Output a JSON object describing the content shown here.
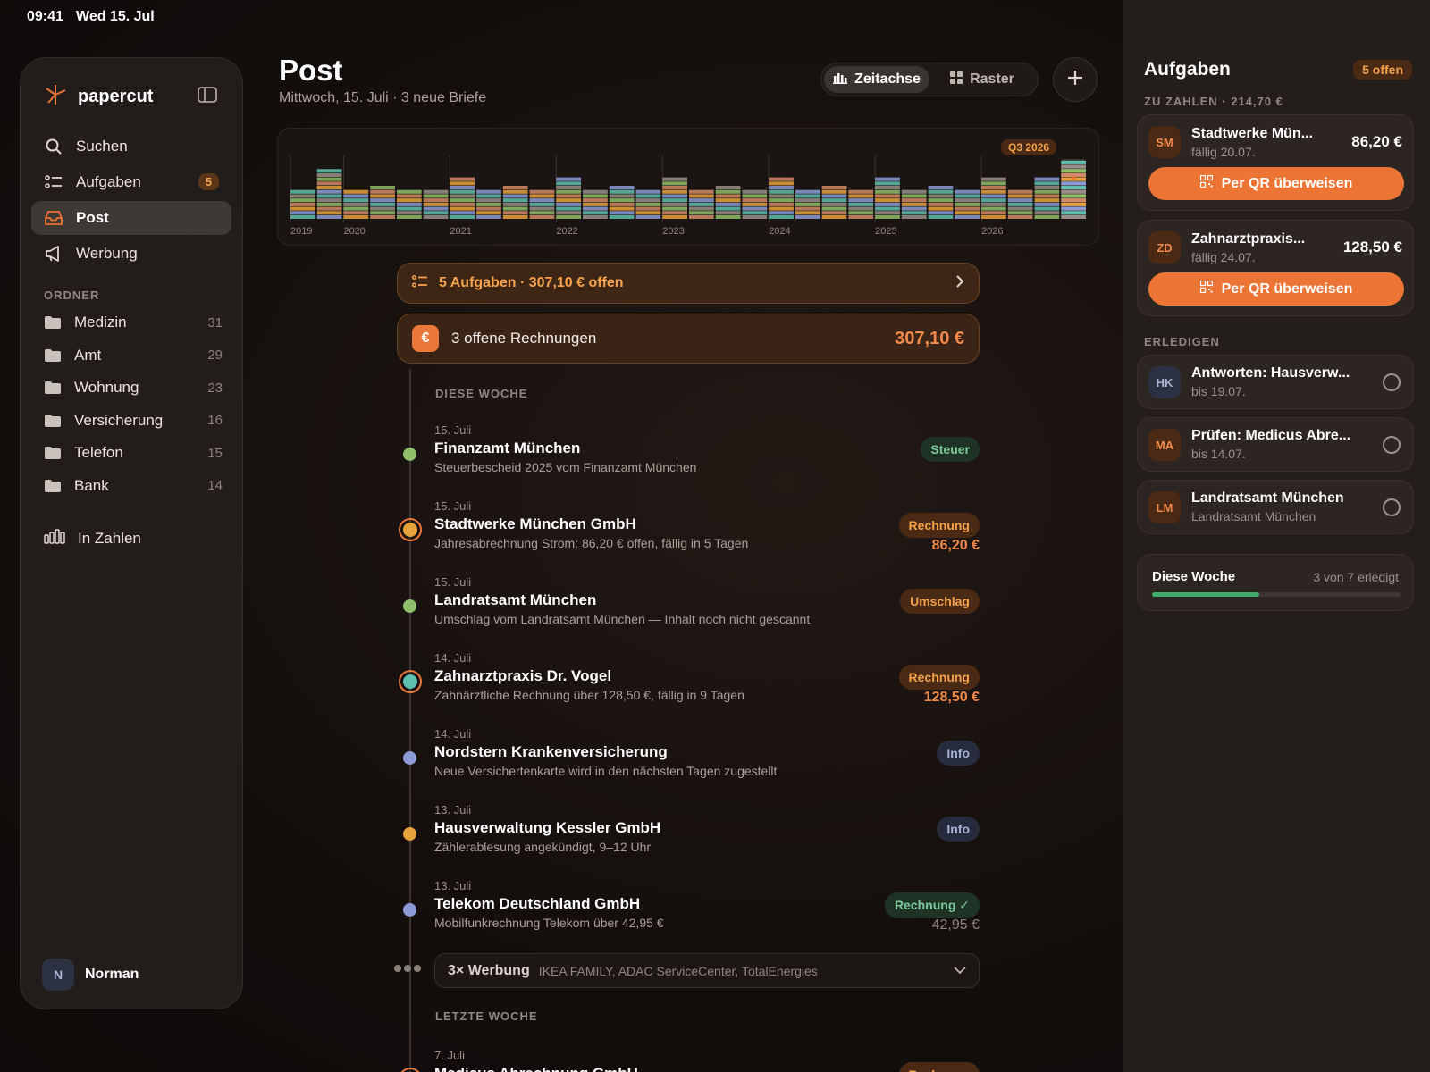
{
  "status": {
    "time": "09:41",
    "date": "Wed 15. Jul"
  },
  "sidebar": {
    "brand": "papercut",
    "nav": [
      {
        "label": "Suchen",
        "icon": "search-icon"
      },
      {
        "label": "Aufgaben",
        "icon": "task-list-icon",
        "badge": "5"
      },
      {
        "label": "Post",
        "icon": "inbox-icon",
        "active": true
      },
      {
        "label": "Werbung",
        "icon": "megaphone-icon"
      }
    ],
    "folders_label": "ORDNER",
    "folders": [
      {
        "label": "Medizin",
        "count": "31"
      },
      {
        "label": "Amt",
        "count": "29"
      },
      {
        "label": "Wohnung",
        "count": "23"
      },
      {
        "label": "Versicherung",
        "count": "16"
      },
      {
        "label": "Telefon",
        "count": "15"
      },
      {
        "label": "Bank",
        "count": "14"
      }
    ],
    "stats_label": "In Zahlen",
    "user": {
      "initial": "N",
      "name": "Norman"
    }
  },
  "main": {
    "title": "Post",
    "subtitle": "Mittwoch, 15. Juli · 3 neue Briefe",
    "view_toggle": {
      "timeline": "Zeitachse",
      "grid": "Raster",
      "active": "timeline"
    },
    "tasks_banner": "5 Aufgaben · 307,10 € offen",
    "invoice_banner": {
      "symbol": "€",
      "text": "3 offene Rechnungen",
      "amount": "307,10 €"
    },
    "group_this_week": "DIESE WOCHE",
    "group_last_week": "LETZTE WOCHE",
    "entries": [
      {
        "date": "15. Juli",
        "title": "Finanzamt München",
        "desc": "Steuerbescheid 2025 vom Finanzamt München",
        "tag": "Steuer",
        "tag_type": "steuer",
        "dot_color": "#8fbf6a",
        "ring": false,
        "amount": ""
      },
      {
        "date": "15. Juli",
        "title": "Stadtwerke München GmbH",
        "desc": "Jahresabrechnung Strom: 86,20 € offen, fällig in 5 Tagen",
        "tag": "Rechnung",
        "tag_type": "rechnung",
        "dot_color": "#e8a23c",
        "ring": true,
        "amount": "86,20 €"
      },
      {
        "date": "15. Juli",
        "title": "Landratsamt München",
        "desc": "Umschlag vom Landratsamt München — Inhalt noch nicht gescannt",
        "tag": "Umschlag",
        "tag_type": "umschlag",
        "dot_color": "#8fbf6a",
        "ring": false,
        "amount": ""
      },
      {
        "date": "14. Juli",
        "title": "Zahnarztpraxis Dr. Vogel",
        "desc": "Zahnärztliche Rechnung über 128,50 €, fällig in 9 Tagen",
        "tag": "Rechnung",
        "tag_type": "rechnung",
        "dot_color": "#5fbfae",
        "ring": true,
        "amount": "128,50 €"
      },
      {
        "date": "14. Juli",
        "title": "Nordstern Krankenversicherung",
        "desc": "Neue Versichertenkarte wird in den nächsten Tagen zugestellt",
        "tag": "Info",
        "tag_type": "info",
        "dot_color": "#8c9bd6",
        "ring": false,
        "amount": ""
      },
      {
        "date": "13. Juli",
        "title": "Hausverwaltung Kessler GmbH",
        "desc": "Zählerablesung angekündigt, 9–12 Uhr",
        "tag": "Info",
        "tag_type": "info",
        "dot_color": "#e8a23c",
        "ring": false,
        "amount": ""
      },
      {
        "date": "13. Juli",
        "title": "Telekom Deutschland GmbH",
        "desc": "Mobilfunkrechnung Telekom über 42,95 €",
        "tag": "Rechnung ✓",
        "tag_type": "paid",
        "dot_color": "#8c9bd6",
        "ring": false,
        "amount": "42,95 €",
        "amount_paid": true
      }
    ],
    "ads": {
      "count": "3× Werbung",
      "list": "IKEA FAMILY, ADAC ServiceCenter, TotalEnergies"
    },
    "last_entry": {
      "date": "7. Juli",
      "title": "Medicus Abrechnung GmbH",
      "tag": "Rechnung",
      "dot_color": "#5fbfae"
    }
  },
  "chart_data": {
    "type": "bar",
    "stacked": true,
    "badge": "Q3 2026",
    "year_labels": [
      "2019",
      "2020",
      "2021",
      "2022",
      "2023",
      "2024",
      "2025",
      "2026"
    ],
    "year_start_index": [
      0,
      2,
      6,
      10,
      14,
      18,
      22,
      26
    ],
    "colors": [
      "#5fbfae",
      "#8c9bd6",
      "#e8a23c",
      "#d38a6a",
      "#8fbf6a",
      "#9a8f88"
    ],
    "quarter_totals": [
      7,
      12,
      7,
      8,
      7,
      7,
      10,
      7,
      8,
      7,
      10,
      7,
      8,
      7,
      10,
      7,
      8,
      7,
      10,
      7,
      8,
      7,
      10,
      7,
      8,
      7,
      10,
      7,
      10,
      14
    ],
    "current_quarter_index": 29
  },
  "rpanel": {
    "title": "Aufgaben",
    "badge": "5 offen",
    "pay_label": "ZU ZAHLEN · 214,70 €",
    "pay_items": [
      {
        "mono": "SM",
        "title": "Stadtwerke Mün...",
        "due": "fällig 20.07.",
        "amount": "86,20 €",
        "button": "Per QR überweisen"
      },
      {
        "mono": "ZD",
        "title": "Zahnarztpraxis...",
        "due": "fällig 24.07.",
        "amount": "128,50 €",
        "button": "Per QR überweisen"
      }
    ],
    "todo_label": "ERLEDIGEN",
    "todos": [
      {
        "mono": "HK",
        "mono_style": "blue",
        "title": "Antworten: Hausverw...",
        "sub": "bis 19.07."
      },
      {
        "mono": "MA",
        "mono_style": "orange",
        "title": "Prüfen: Medicus Abre...",
        "sub": "bis 14.07."
      },
      {
        "mono": "LM",
        "mono_style": "orange",
        "title": "Landratsamt München",
        "sub": "Landratsamt München"
      }
    ],
    "week": {
      "title": "Diese Woche",
      "count": "3 von 7 erledigt",
      "progress": 0.43
    }
  }
}
